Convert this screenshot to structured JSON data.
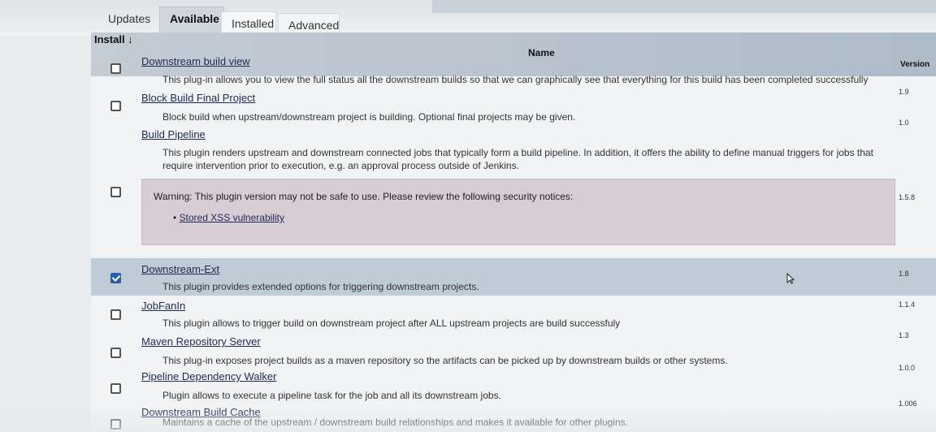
{
  "tabs": [
    {
      "label": "Updates"
    },
    {
      "label": "Available"
    },
    {
      "label": "Installed"
    },
    {
      "label": "Advanced"
    }
  ],
  "table": {
    "headers": {
      "install": "Install ↓",
      "name": "Name",
      "version": "Version"
    },
    "rows": [
      {
        "name": "Downstream build view",
        "description": "This plug-in allows you to view the full status all the downstream builds so that we can graphically see that everything for this build has been completed successfully",
        "version": "1.9",
        "checked": false
      },
      {
        "name": "Block Build Final Project",
        "description": "Block build when upstream/downstream project is building. Optional final projects may be given.",
        "version": "1.0",
        "checked": false
      },
      {
        "name": "Build Pipeline",
        "description": "This plugin renders upstream and downstream connected jobs that typically form a build pipeline. In addition, it offers the ability to define manual triggers for jobs that require intervention prior to execution, e.g. an approval process outside of Jenkins.",
        "version": "1.5.8",
        "checked": false
      },
      {
        "name": "Downstream-Ext",
        "description": "This plugin provides extended options for triggering downstream projects.",
        "version": "1.8",
        "checked": true
      },
      {
        "name": "JobFanIn",
        "description": "This plugin allows to trigger build on downstream project after ALL upstream projects are build successfuly",
        "version": "1.1.4",
        "checked": false
      },
      {
        "name": "Maven Repository Server",
        "description": "This plug-in exposes project builds as a maven repository so the artifacts can be picked up by downstream builds or other systems.",
        "version": "1.3",
        "checked": false
      },
      {
        "name": "Pipeline Dependency Walker",
        "description": "Plugin allows to execute a pipeline task for the job and all its downstream jobs.",
        "version": "1.0.0",
        "checked": false
      },
      {
        "name": "Downstream Build Cache",
        "description": "Maintains a cache of the upstream / downstream build relationships and makes it available for other plugins.",
        "version": "1.006",
        "checked": false
      }
    ]
  },
  "warning": {
    "text": "Warning: This plugin version may not be safe to use. Please review the following security notices:",
    "link": "Stored XSS vulnerability"
  },
  "colors": {
    "header_bg": "#b6c2ce",
    "selected_row": "#bfcbd7",
    "warning_bg": "#d8ccd5",
    "link": "#1d2a55",
    "checkbox_checked": "#2c5ea8"
  }
}
